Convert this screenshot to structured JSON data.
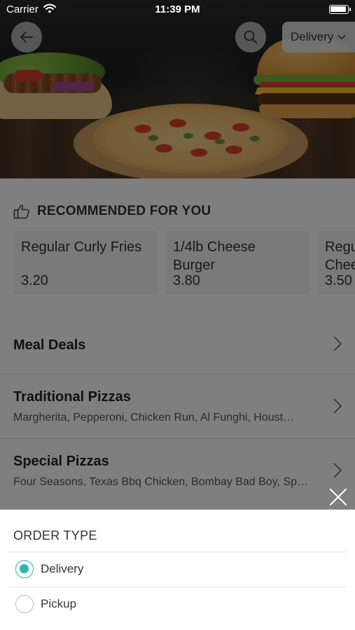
{
  "status_bar": {
    "carrier": "Carrier",
    "time": "11:39 PM"
  },
  "header": {
    "order_type_label": "Delivery",
    "icons": {
      "back": "arrow-left-icon",
      "search": "search-icon",
      "dropdown": "chevron-down-icon"
    }
  },
  "recommended": {
    "title": "RECOMMENDED FOR YOU",
    "icon": "thumbs-up-icon",
    "items": [
      {
        "name": "Regular Curly Fries",
        "price": "3.20"
      },
      {
        "name": "1/4lb Cheese Burger",
        "name_line1": "1/4lb Cheese",
        "name_line2": "Burger",
        "price": "3.80"
      },
      {
        "name_line1": "Regu",
        "name_line2": "Chee",
        "price": "3.50"
      }
    ]
  },
  "categories": [
    {
      "name": "Meal Deals",
      "description": ""
    },
    {
      "name": "Traditional Pizzas",
      "description": "Margherita, Pepperoni, Chicken Run, Al Funghi, Houst…"
    },
    {
      "name": "Special Pizzas",
      "description": "Four Seasons, Texas Bbq Chicken, Bombay Bad Boy, Sp…"
    }
  ],
  "order_type_sheet": {
    "title": "ORDER TYPE",
    "options": [
      {
        "label": "Delivery",
        "selected": true
      },
      {
        "label": "Pickup",
        "selected": false
      }
    ],
    "close_icon": "close-icon"
  },
  "colors": {
    "accent": "#2fb5b0",
    "overlay": "rgba(0,0,0,0.5)"
  }
}
